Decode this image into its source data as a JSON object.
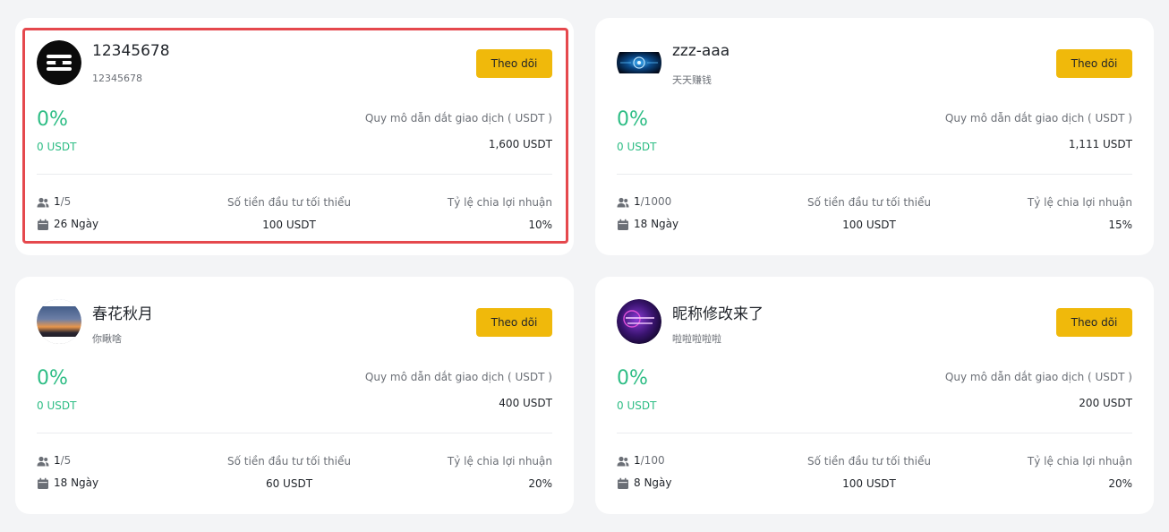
{
  "labels": {
    "follow": "Theo dõi",
    "scale": "Quy mô dẫn dắt giao dịch ( USDT )",
    "min_invest": "Số tiền đầu tư tối thiểu",
    "profit_share": "Tỷ lệ chia lợi nhuận"
  },
  "colors": {
    "accent": "#f0b90b",
    "positive": "#2ebd85",
    "highlight_border": "#e5484d"
  },
  "cards": [
    {
      "name": "12345678",
      "subtitle": "12345678",
      "pct": "0%",
      "pct_usdt": "0 USDT",
      "scale_value": "1,600 USDT",
      "followers_current": "1",
      "followers_max": "/5",
      "days": "26 Ngày",
      "min_invest": "100 USDT",
      "profit_share": "10%",
      "highlighted": true
    },
    {
      "name": "zzz-aaa",
      "subtitle": "天天赚钱",
      "pct": "0%",
      "pct_usdt": "0 USDT",
      "scale_value": "1,111 USDT",
      "followers_current": "1",
      "followers_max": "/1000",
      "days": "18 Ngày",
      "min_invest": "100 USDT",
      "profit_share": "15%"
    },
    {
      "name": "春花秋月",
      "subtitle": "你瞅啥",
      "pct": "0%",
      "pct_usdt": "0 USDT",
      "scale_value": "400 USDT",
      "followers_current": "1",
      "followers_max": "/5",
      "days": "18 Ngày",
      "min_invest": "60 USDT",
      "profit_share": "20%"
    },
    {
      "name": "昵称修改来了",
      "subtitle": "啦啦啦啦啦",
      "pct": "0%",
      "pct_usdt": "0 USDT",
      "scale_value": "200 USDT",
      "followers_current": "1",
      "followers_max": "/100",
      "days": "8 Ngày",
      "min_invest": "100 USDT",
      "profit_share": "20%"
    }
  ]
}
